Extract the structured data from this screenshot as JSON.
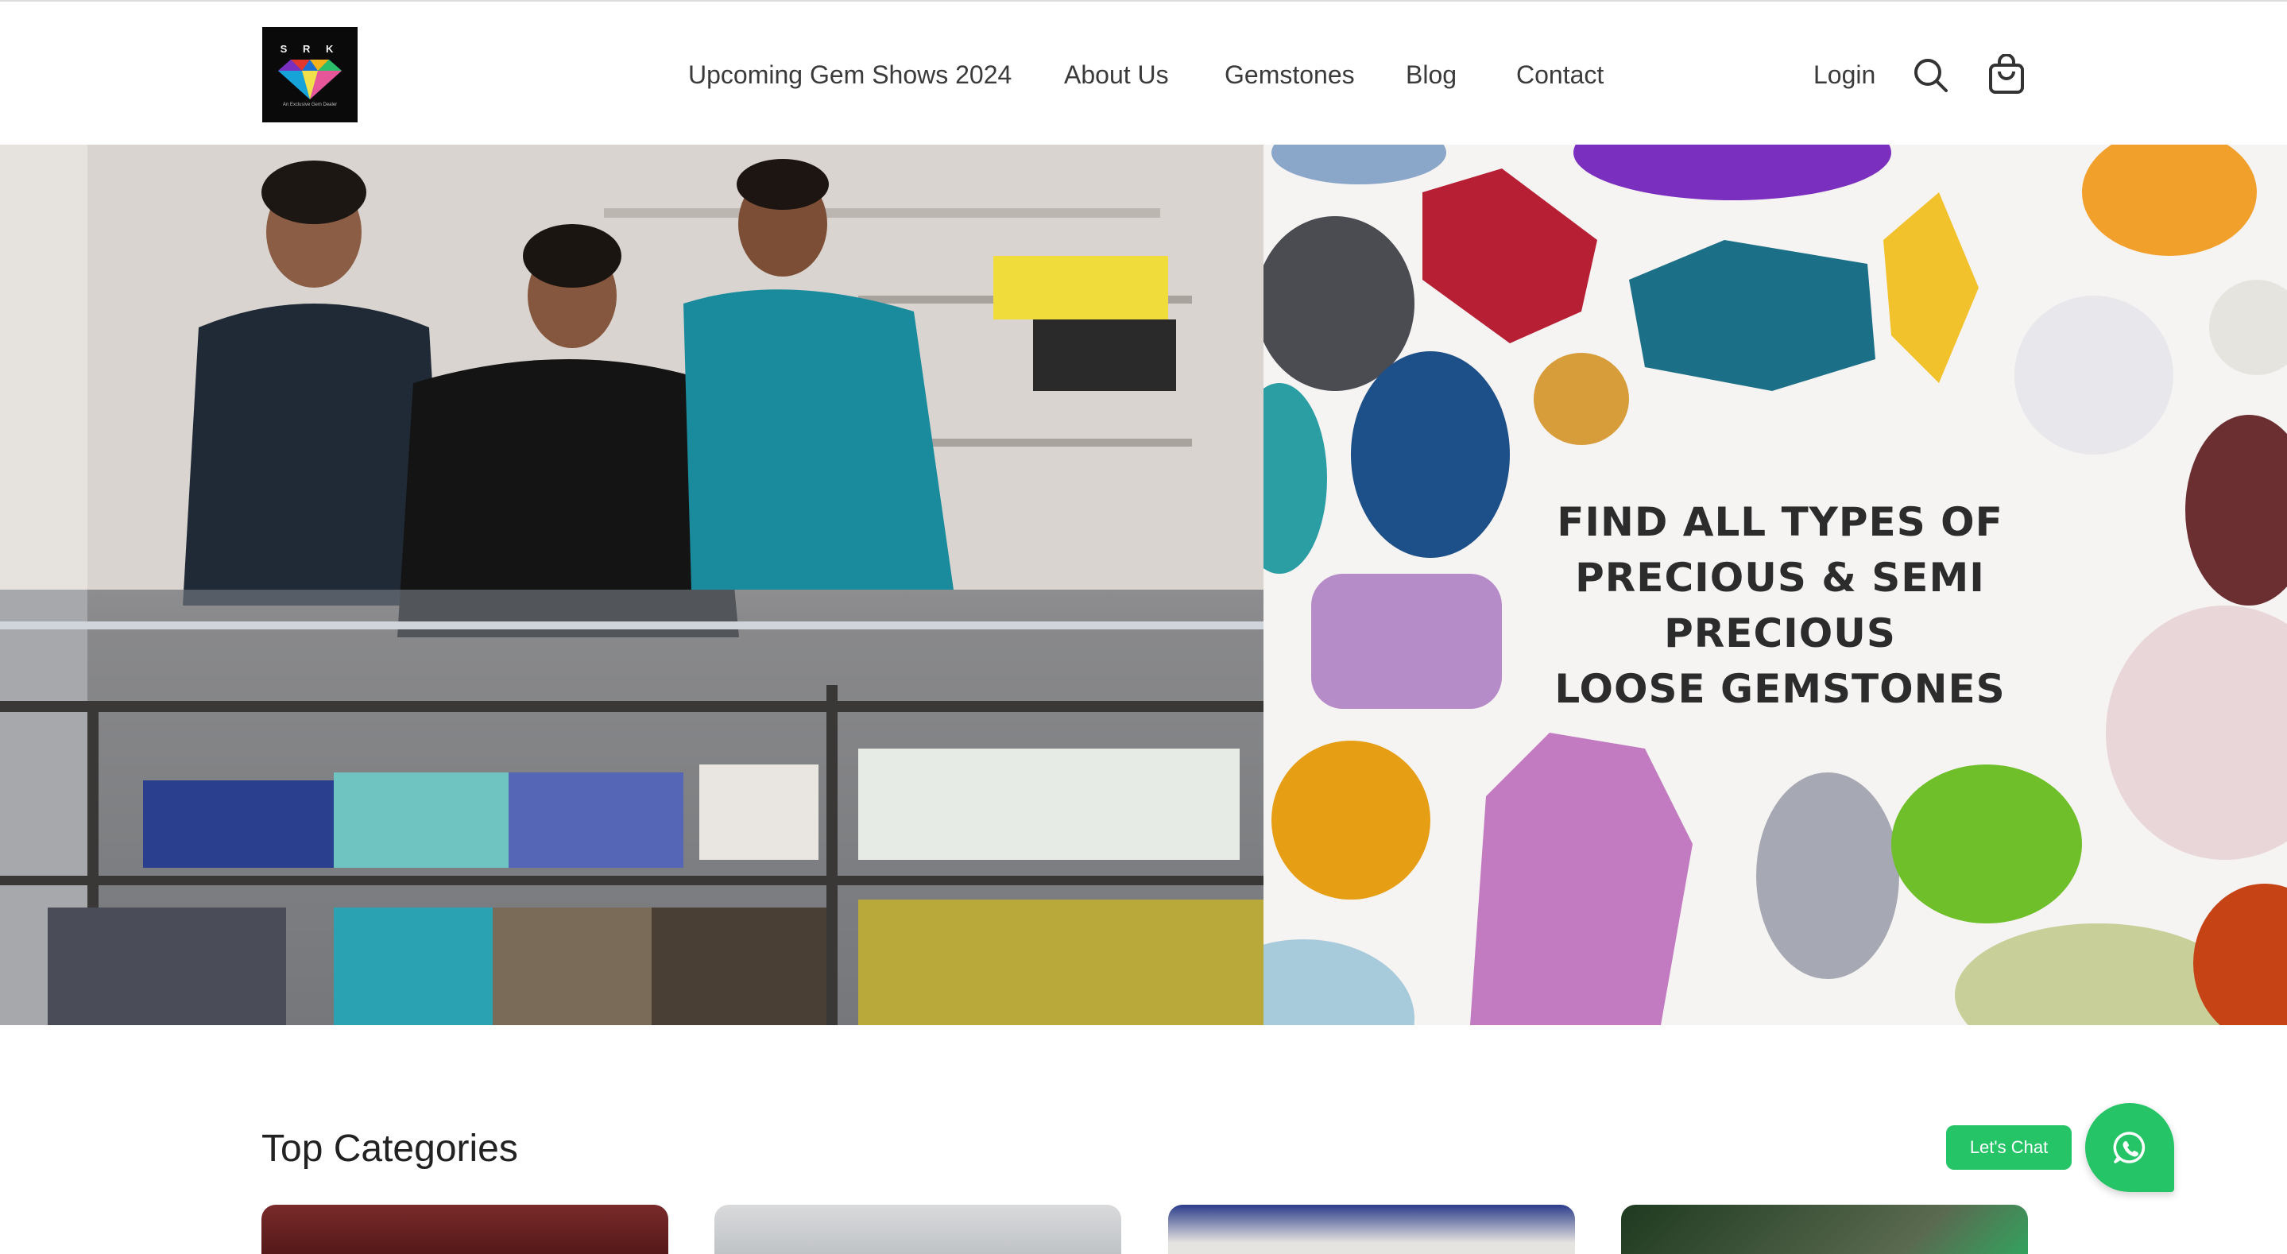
{
  "header": {
    "logo": {
      "text": "S R K",
      "tagline": "An Exclusive Gem Dealer",
      "alt": "SRK logo"
    },
    "nav": [
      {
        "label": "Upcoming Gem Shows 2024"
      },
      {
        "label": "About Us"
      },
      {
        "label": "Gemstones"
      },
      {
        "label": "Blog"
      },
      {
        "label": "Contact"
      }
    ],
    "login_label": "Login",
    "icons": {
      "search": "search-icon",
      "cart": "cart-icon"
    }
  },
  "hero": {
    "left_image_alt": "Gem dealers standing behind display case",
    "caption_lines": [
      "FIND ALL TYPES OF",
      "PRECIOUS & SEMI PRECIOUS",
      "LOOSE GEMSTONES"
    ]
  },
  "categories": {
    "title": "Top Categories",
    "cards": [
      {
        "alt": "category image 1"
      },
      {
        "alt": "category image 2"
      },
      {
        "alt": "category image 3"
      },
      {
        "alt": "category image 4"
      }
    ]
  },
  "chat": {
    "label": "Let's Chat",
    "icon": "whatsapp-icon",
    "color": "#25c466"
  }
}
